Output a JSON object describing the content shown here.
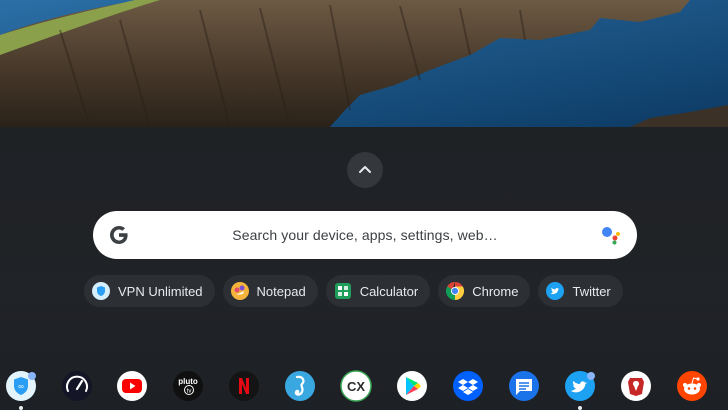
{
  "launcher": {
    "expand_icon": "chevron-up-icon",
    "search": {
      "placeholder": "Search your device, apps, settings, web…",
      "left_icon": "google-g-icon",
      "right_icon": "google-assistant-icon"
    },
    "suggestions": [
      {
        "label": "VPN Unlimited",
        "icon": "vpn-unlimited-icon"
      },
      {
        "label": "Notepad",
        "icon": "notepad-icon"
      },
      {
        "label": "Calculator",
        "icon": "calculator-icon"
      },
      {
        "label": "Chrome",
        "icon": "chrome-icon"
      },
      {
        "label": "Twitter",
        "icon": "twitter-icon"
      }
    ]
  },
  "shelf": {
    "apps": [
      {
        "icon": "vpn-unlimited-icon",
        "running": true
      },
      {
        "icon": "speedtest-icon",
        "running": false
      },
      {
        "icon": "youtube-icon",
        "running": false
      },
      {
        "icon": "pluto-tv-icon",
        "text": "pluto tv",
        "running": false
      },
      {
        "icon": "netflix-icon",
        "text": "N",
        "running": false
      },
      {
        "icon": "seahorse-app-icon",
        "running": false
      },
      {
        "icon": "cx-file-explorer-icon",
        "text": "CX",
        "running": false
      },
      {
        "icon": "google-play-icon",
        "running": false
      },
      {
        "icon": "dropbox-icon",
        "running": false
      },
      {
        "icon": "messages-icon",
        "running": false
      },
      {
        "icon": "twitter-icon",
        "running": true
      },
      {
        "icon": "shield-app-icon",
        "running": false
      },
      {
        "icon": "reddit-icon",
        "running": false
      }
    ]
  },
  "colors": {
    "launcher_bg": "#1f2225",
    "chip_bg": "#2c2f33",
    "search_bg": "#ffffff",
    "text_light": "#e8eaed"
  }
}
